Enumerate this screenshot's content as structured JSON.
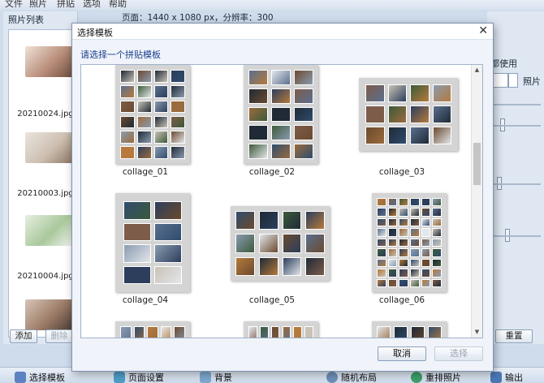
{
  "menu": {
    "items": [
      "文件",
      "照片",
      "拼贴",
      "选项",
      "帮助"
    ]
  },
  "page_info": "页面：1440 x 1080 px，分辨率：300",
  "left_panel": {
    "title": "照片列表",
    "photos": [
      {
        "name": "20210024.jpg",
        "color": "#c9a592"
      },
      {
        "name": "20210003.jpg",
        "color": "#d9cfc4"
      },
      {
        "name": "20210004.jpg",
        "color": "#b7cfa8"
      },
      {
        "name": "",
        "color": "#a88a78"
      }
    ],
    "add_label": "添加",
    "delete_label": "删除"
  },
  "right_panel": {
    "use_label": "都使用",
    "photo_label": "照片",
    "reset_label": "重置"
  },
  "bottom_toolbar": {
    "items": [
      {
        "label": "选择模板",
        "icon": "template-icon",
        "color": "#5b82c2"
      },
      {
        "label": "页面设置",
        "icon": "page-settings-icon",
        "color": "#4f9ec8"
      },
      {
        "label": "背景",
        "icon": "background-icon",
        "color": "#7ea9cf"
      },
      {
        "label": "随机布局",
        "icon": "random-layout-icon",
        "color": "#6f8fb8"
      },
      {
        "label": "重排照片",
        "icon": "rearrange-icon",
        "color": "#3f9f6a"
      },
      {
        "label": "输出",
        "icon": "output-icon",
        "color": "#4a78b5"
      }
    ]
  },
  "dialog": {
    "title": "选择模板",
    "close_glyph": "✕",
    "prompt": "请选择一个拼贴模板",
    "templates": [
      {
        "name": "collage_01"
      },
      {
        "name": "collage_02"
      },
      {
        "name": "collage_03"
      },
      {
        "name": "collage_04"
      },
      {
        "name": "collage_05"
      },
      {
        "name": "collage_06"
      },
      {
        "name": ""
      },
      {
        "name": ""
      },
      {
        "name": ""
      }
    ],
    "cancel_label": "取消",
    "select_label": "选择"
  }
}
